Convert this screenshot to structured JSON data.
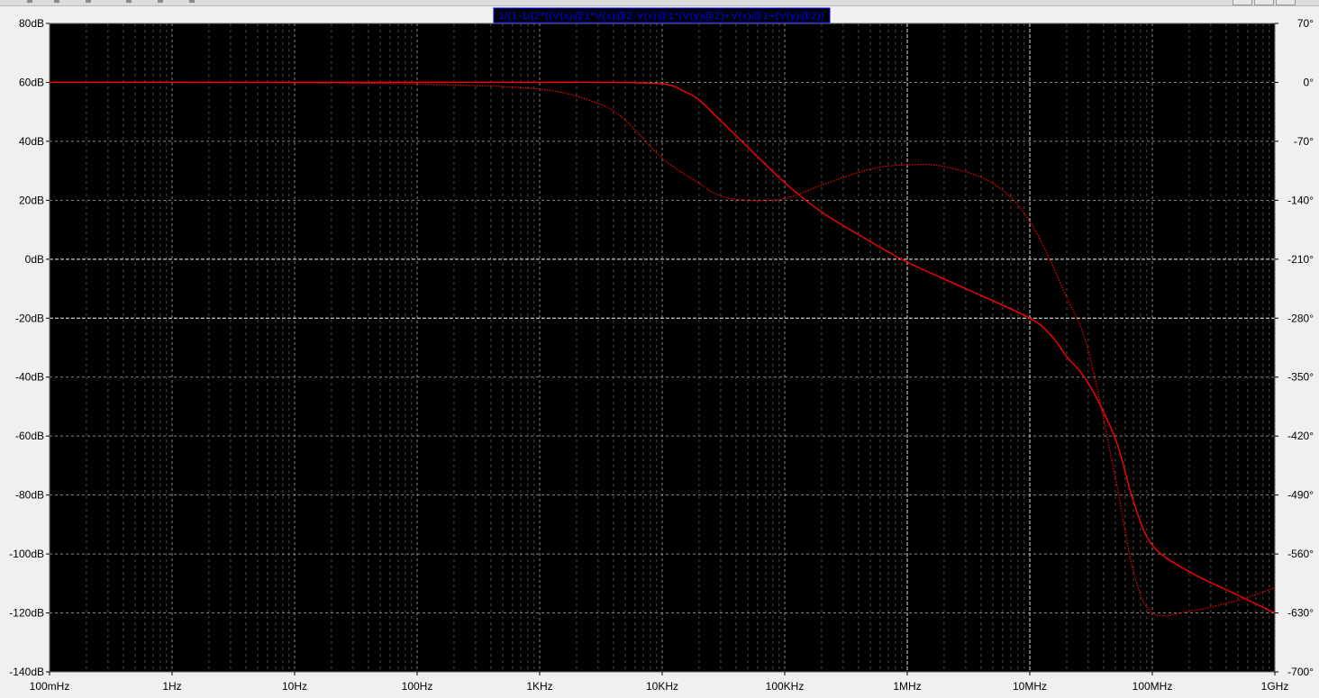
{
  "window": {
    "trace_expression": "1/(1-1/(2*((V(x)@1*V(x)@2-V(x)@1*(V(y)@2)+V(x)@1+(V(y)@2))"
  },
  "chart_data": {
    "type": "line",
    "x_scale": "log",
    "x_ticks": [
      "100mHz",
      "1Hz",
      "10Hz",
      "100Hz",
      "1KHz",
      "10KHz",
      "100KHz",
      "1MHz",
      "10MHz",
      "100MHz",
      "1GHz"
    ],
    "x_tick_values": [
      0.1,
      1,
      10,
      100,
      1000,
      10000,
      100000,
      1000000,
      10000000,
      100000000,
      1000000000
    ],
    "y_left_ticks": [
      "80dB",
      "60dB",
      "40dB",
      "20dB",
      "0dB",
      "-20dB",
      "-40dB",
      "-60dB",
      "-80dB",
      "-100dB",
      "-120dB",
      "-140dB"
    ],
    "y_left_values": [
      80,
      60,
      40,
      20,
      0,
      -20,
      -40,
      -60,
      -80,
      -100,
      -120,
      -140
    ],
    "y_left_range": [
      -140,
      80
    ],
    "y_right_ticks": [
      "70°",
      "0°",
      "-70°",
      "-140°",
      "-210°",
      "-280°",
      "-350°",
      "-420°",
      "-490°",
      "-560°",
      "-630°",
      "-700°"
    ],
    "y_right_values": [
      70,
      0,
      -70,
      -140,
      -210,
      -280,
      -350,
      -420,
      -490,
      -560,
      -630,
      -700
    ],
    "y_right_range": [
      -700,
      70
    ],
    "grid": true,
    "series": [
      {
        "style": "solid",
        "axis": "left",
        "color": "#ff0000",
        "x": [
          0.1,
          1,
          10,
          100,
          1000,
          3000,
          10000,
          15000,
          20000,
          30000,
          50000,
          100000,
          200000,
          500000,
          1000000,
          3000000,
          10000000,
          15000000,
          20000000,
          30000000,
          50000000,
          70000000,
          100000000,
          200000000,
          500000000,
          1000000000
        ],
        "y": [
          60,
          60,
          60,
          60,
          60,
          60,
          59.5,
          57,
          54,
          47,
          38,
          26,
          16,
          6,
          -1,
          -10,
          -20,
          -26,
          -33,
          -42,
          -61,
          -82,
          -97,
          -106,
          -114,
          -120
        ]
      },
      {
        "style": "dotted",
        "axis": "right",
        "color": "#ff0000",
        "x": [
          0.1,
          1,
          10,
          100,
          1000,
          3000,
          5000,
          10000,
          20000,
          30000,
          50000,
          100000,
          200000,
          500000,
          1000000,
          2000000,
          5000000,
          10000000,
          20000000,
          30000000,
          50000000,
          70000000,
          100000000,
          200000000,
          500000000,
          1000000000
        ],
        "y": [
          0,
          0,
          -0.5,
          -2,
          -8,
          -25,
          -45,
          -90,
          -120,
          -135,
          -140,
          -138,
          -122,
          -103,
          -98,
          -100,
          -120,
          -165,
          -255,
          -318,
          -470,
          -580,
          -630,
          -628,
          -615,
          -600
        ]
      }
    ]
  }
}
